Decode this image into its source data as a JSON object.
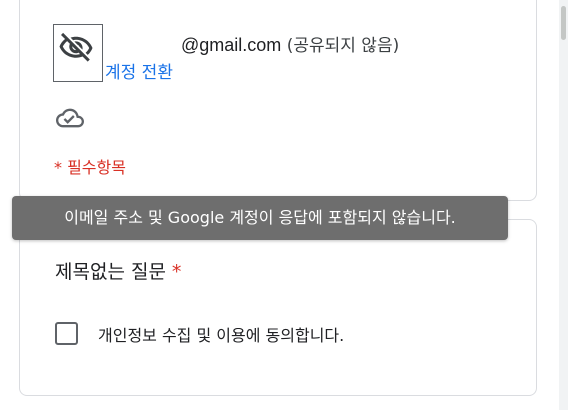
{
  "account": {
    "email": "@gmail.com",
    "share_note": "(공유되지 않음)",
    "switch_account_label": "계정 전환"
  },
  "required_note": "* 필수항목",
  "toast": {
    "message": "이메일 주소 및 Google 계정이 응답에 포함되지 않습니다."
  },
  "question": {
    "title": "제목없는 질문",
    "required_mark": "*",
    "checkbox_label": "개인정보 수집 및 이용에 동의합니다.",
    "checked": false
  },
  "icons": {
    "avatar": "eye-off-icon",
    "save_status": "cloud-done-icon"
  },
  "colors": {
    "link": "#1a73e8",
    "required": "#d93025",
    "toast_bg": "#6e6e6e"
  }
}
